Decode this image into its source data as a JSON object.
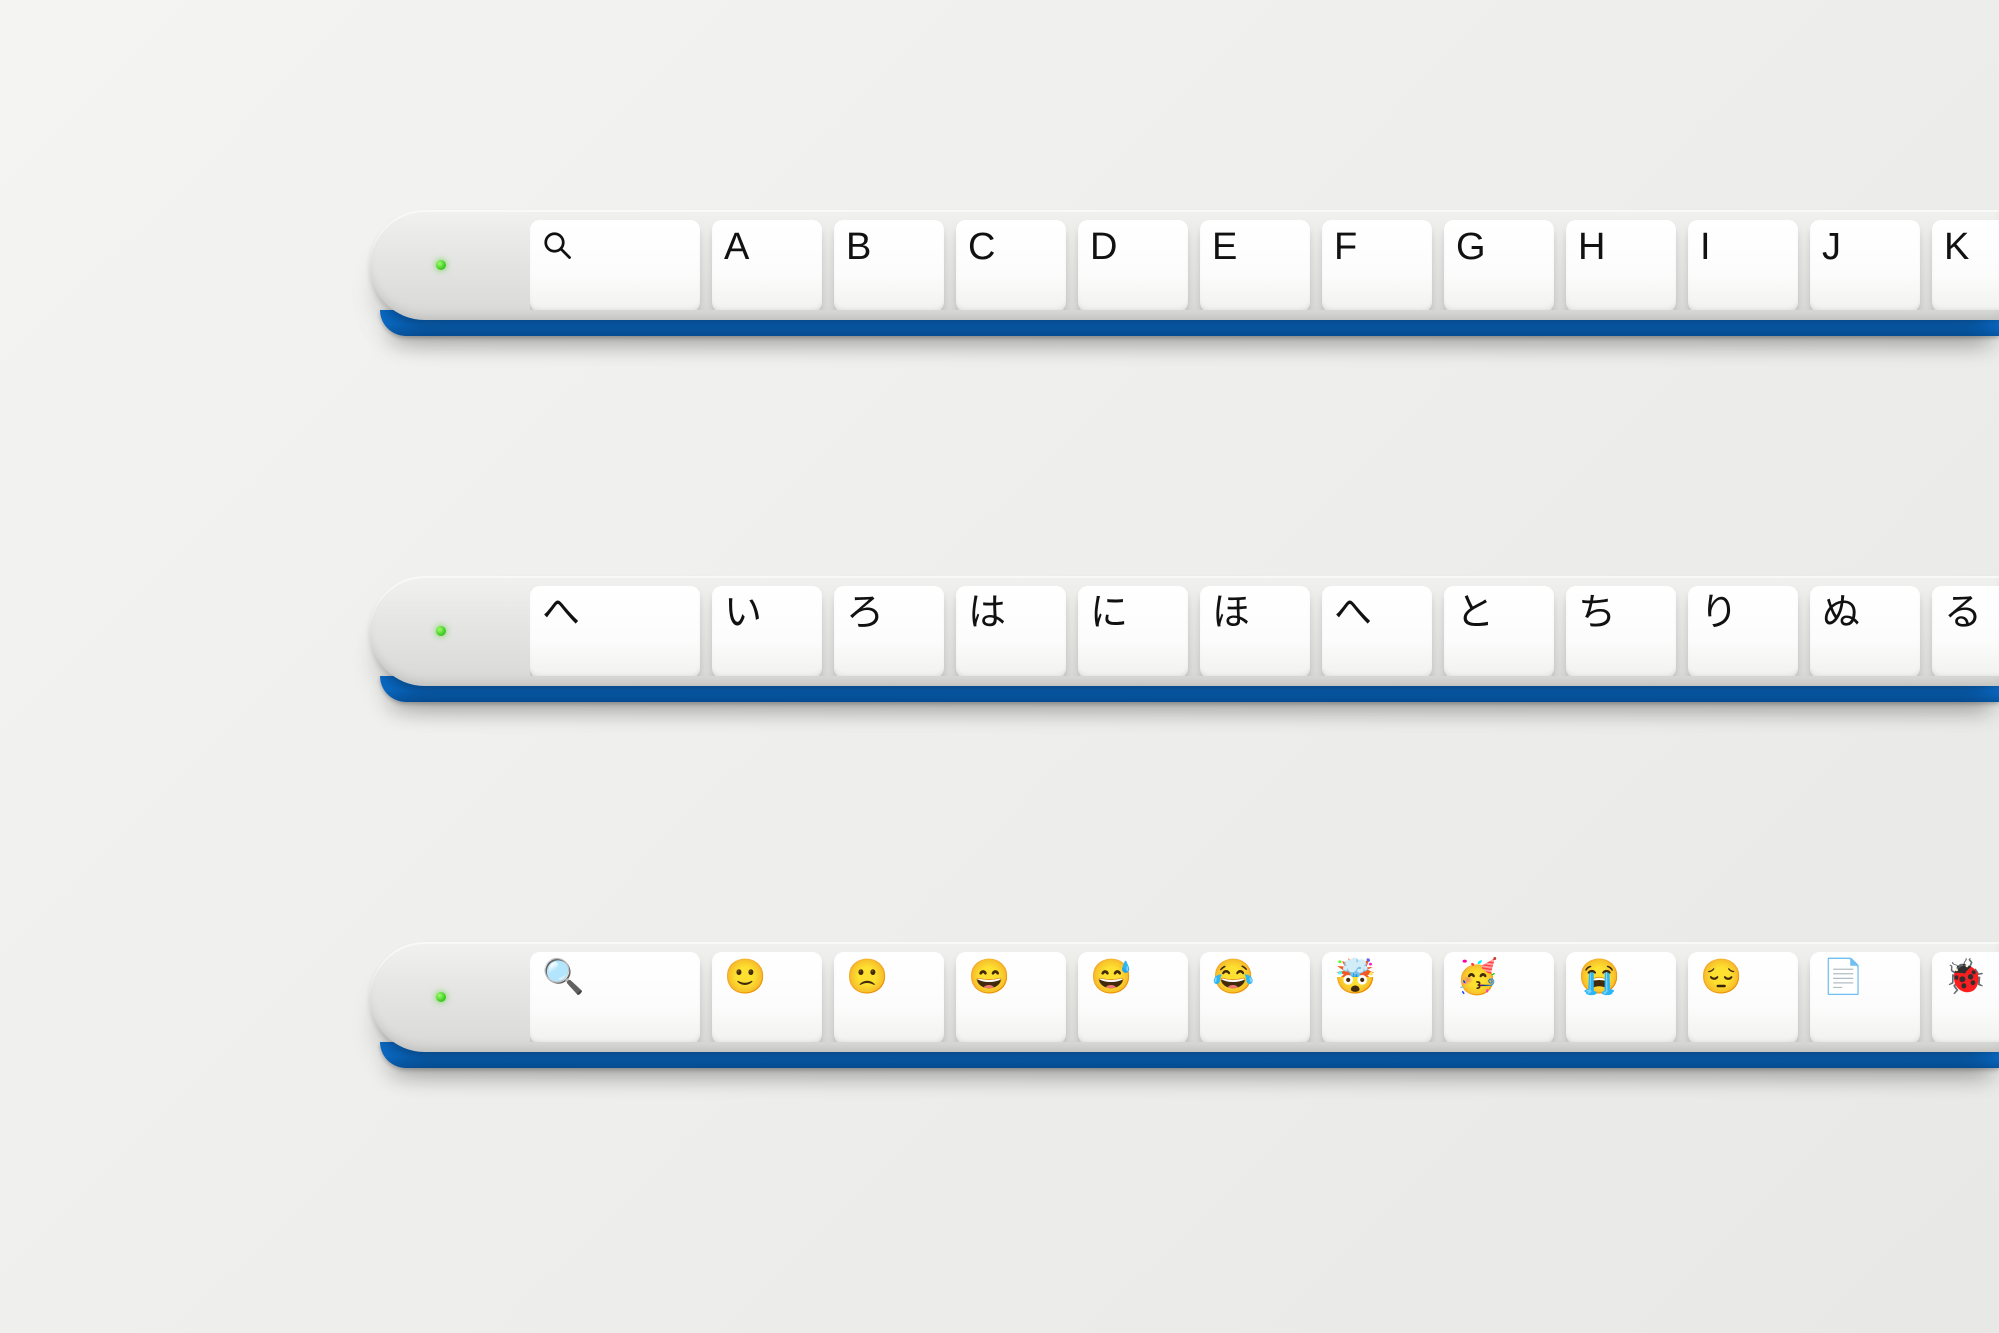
{
  "rows": [
    {
      "id": "latin",
      "led": true,
      "first_key": {
        "type": "icon",
        "name": "search-icon",
        "value": "search"
      },
      "keys": [
        "A",
        "B",
        "C",
        "D",
        "E",
        "F",
        "G",
        "H",
        "I",
        "J",
        "K"
      ]
    },
    {
      "id": "hiragana",
      "led": true,
      "first_key": {
        "type": "text",
        "value": "へ"
      },
      "keys": [
        "い",
        "ろ",
        "は",
        "に",
        "ほ",
        "へ",
        "と",
        "ち",
        "り",
        "ぬ",
        "る"
      ]
    },
    {
      "id": "emoji",
      "led": true,
      "first_key": {
        "type": "emoji",
        "value": "🔍"
      },
      "keys": [
        "🙂",
        "🙁",
        "😄",
        "😅",
        "😂",
        "🤯",
        "🥳",
        "😭",
        "😔",
        "📄",
        "🐞"
      ]
    }
  ],
  "colors": {
    "accent_base": "#0a6fcf",
    "led": "#48d02a"
  }
}
